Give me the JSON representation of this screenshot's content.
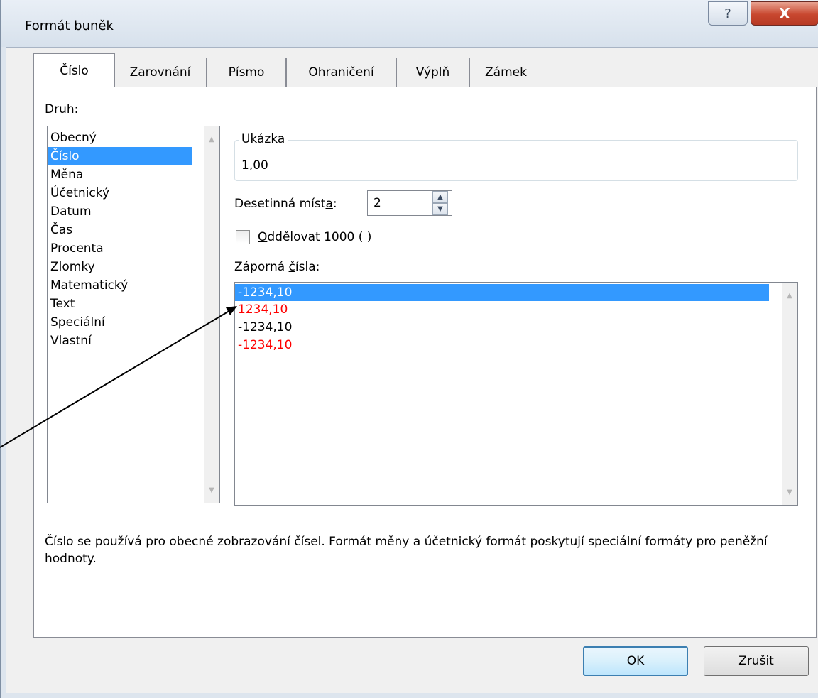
{
  "window": {
    "title": "Formát buněk",
    "help_glyph": "?",
    "close_glyph": "X"
  },
  "tabs": [
    {
      "label": "Číslo",
      "active": true
    },
    {
      "label": "Zarovnání"
    },
    {
      "label": "Písmo"
    },
    {
      "label": "Ohraničení"
    },
    {
      "label": "Výplň"
    },
    {
      "label": "Zámek"
    }
  ],
  "category": {
    "label_first": "D",
    "label_rest": "ruh:",
    "items": [
      "Obecný",
      "Číslo",
      "Měna",
      "Účetnický",
      "Datum",
      "Čas",
      "Procenta",
      "Zlomky",
      "Matematický",
      "Text",
      "Speciální",
      "Vlastní"
    ],
    "selected": "Číslo"
  },
  "sample": {
    "label": "Ukázka",
    "value": "1,00"
  },
  "decimals": {
    "label_pre": "Desetinná míst",
    "label_mnemonic": "a",
    "label_post": ":",
    "value": "2"
  },
  "separator": {
    "label_mnemonic": "O",
    "label_rest": "ddělovat 1000 ( )",
    "checked": false
  },
  "negative": {
    "label_pre": "Záporná ",
    "label_mnemonic": "č",
    "label_post": "ísla:",
    "items": [
      {
        "text": "-1234,10",
        "color": "#000000"
      },
      {
        "text": "1234,10",
        "color": "#ff0000"
      },
      {
        "text": "-1234,10",
        "color": "#000000"
      },
      {
        "text": "-1234,10",
        "color": "#ff0000"
      }
    ],
    "selected_index": 0
  },
  "description": "Číslo se používá pro obecné zobrazování čísel. Formát měny a účetnický formát poskytují speciální formáty pro peněžní hodnoty.",
  "buttons": {
    "ok": "OK",
    "cancel": "Zrušit"
  },
  "colors": {
    "selection": "#3399ff",
    "negative_red": "#ff0000"
  }
}
